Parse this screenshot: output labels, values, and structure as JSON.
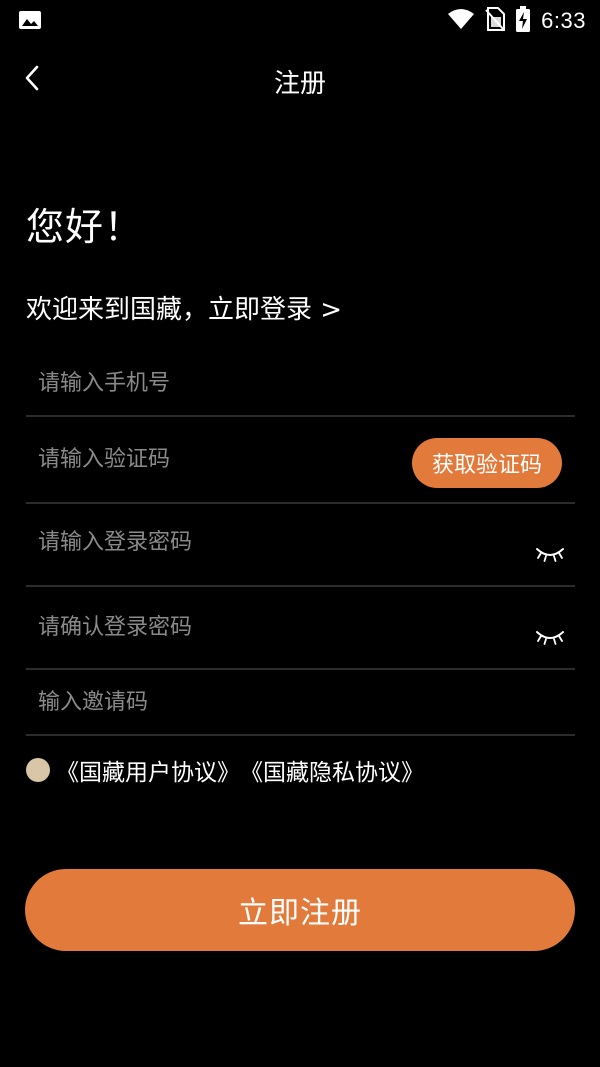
{
  "status_bar": {
    "time": "6:33",
    "icons": [
      "image-notification-icon",
      "wifi-icon",
      "no-sim-icon",
      "battery-charging-icon"
    ]
  },
  "header": {
    "title": "注册",
    "back_icon": "chevron-left-icon"
  },
  "greeting": "您好！",
  "welcome": {
    "text": "欢迎来到国藏，",
    "login_link": "立即登录 >"
  },
  "form": {
    "phone_placeholder": "请输入手机号",
    "code_placeholder": "请输入验证码",
    "get_code_label": "获取验证码",
    "password_placeholder": "请输入登录密码",
    "confirm_password_placeholder": "请确认登录密码",
    "invite_placeholder": "输入邀请码",
    "password_toggle_icon": "eye-closed-icon"
  },
  "agreement": {
    "user_agreement": "《国藏用户协议》",
    "privacy_agreement": "《国藏隐私协议》"
  },
  "register_label": "立即注册",
  "colors": {
    "background": "#000000",
    "accent": "#e27a3b",
    "radio": "#d9c6a6",
    "divider": "#2c2c2c",
    "placeholder": "#8a8a8a"
  }
}
